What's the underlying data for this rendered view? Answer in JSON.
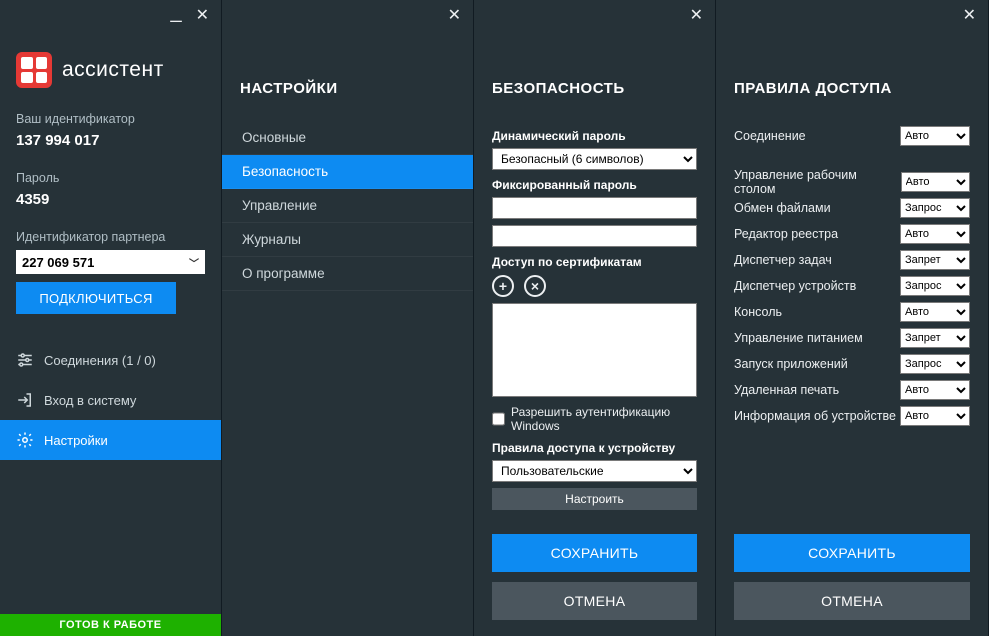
{
  "brand": "ассистент",
  "main": {
    "id_label": "Ваш идентификатор",
    "id_value": "137 994 017",
    "pw_label": "Пароль",
    "pw_value": "4359",
    "partner_label": "Идентификатор партнера",
    "partner_value": "227 069 571",
    "connect": "ПОДКЛЮЧИТЬСЯ",
    "menu": {
      "connections": "Соединения (1 / 0)",
      "login": "Вход в систему",
      "settings": "Настройки"
    },
    "status": "ГОТОВ К РАБОТЕ"
  },
  "settings": {
    "title": "НАСТРОЙКИ",
    "items": [
      "Основные",
      "Безопасность",
      "Управление",
      "Журналы",
      "О программе"
    ],
    "active_index": 1
  },
  "security": {
    "title": "БЕЗОПАСНОСТЬ",
    "dyn_pw_label": "Динамический пароль",
    "dyn_pw_value": "Безопасный (6 символов)",
    "fix_pw_label": "Фиксированный пароль",
    "cert_label": "Доступ по сертификатам",
    "winauth": "Разрешить аутентификацию Windows",
    "device_rules_label": "Правила доступа к устройству",
    "device_rules_value": "Пользовательские",
    "configure": "Настроить",
    "save": "СОХРАНИТЬ",
    "cancel": "ОТМЕНА"
  },
  "access": {
    "title": "ПРАВИЛА ДОСТУПА",
    "options": [
      "Авто",
      "Запрос",
      "Запрет"
    ],
    "rows": [
      {
        "label": "Соединение",
        "value": "Авто"
      },
      {
        "label": "Управление рабочим столом",
        "value": "Авто"
      },
      {
        "label": "Обмен файлами",
        "value": "Запрос"
      },
      {
        "label": "Редактор реестра",
        "value": "Авто"
      },
      {
        "label": "Диспетчер задач",
        "value": "Запрет"
      },
      {
        "label": "Диспетчер устройств",
        "value": "Запрос"
      },
      {
        "label": "Консоль",
        "value": "Авто"
      },
      {
        "label": "Управление питанием",
        "value": "Запрет"
      },
      {
        "label": "Запуск приложений",
        "value": "Запрос"
      },
      {
        "label": "Удаленная печать",
        "value": "Авто"
      },
      {
        "label": "Информация об устройстве",
        "value": "Авто"
      }
    ],
    "save": "СОХРАНИТЬ",
    "cancel": "ОТМЕНА"
  }
}
